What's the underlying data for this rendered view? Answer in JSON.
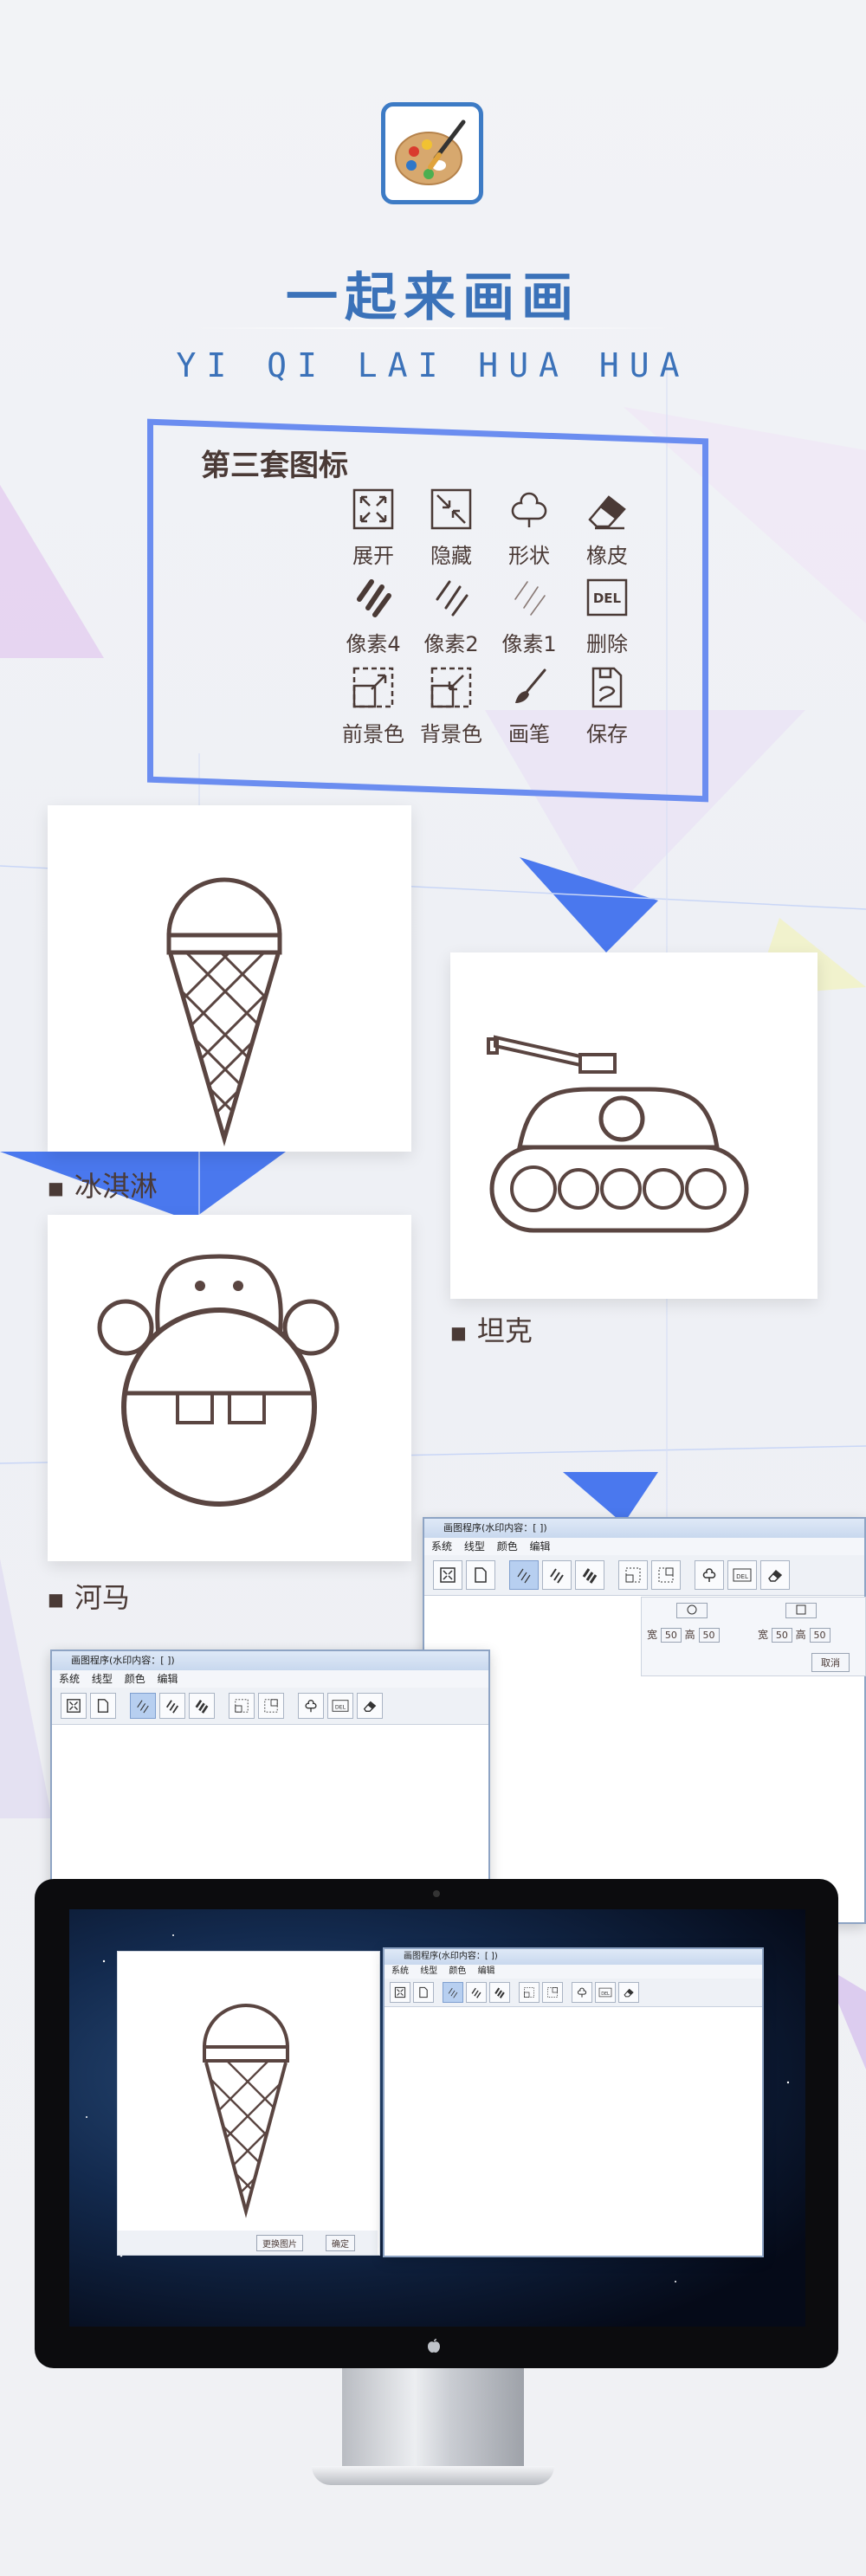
{
  "header": {
    "title": "一起来画画",
    "subtitle": "YI QI LAI HUA HUA"
  },
  "icon_set": {
    "title": "第三套图标",
    "icons": [
      {
        "label": "展开",
        "icon": "expand-icon"
      },
      {
        "label": "隐藏",
        "icon": "collapse-icon"
      },
      {
        "label": "形状",
        "icon": "cloud-shape-icon"
      },
      {
        "label": "橡皮",
        "icon": "eraser-icon"
      },
      {
        "label": "像素4",
        "icon": "pixel4-icon"
      },
      {
        "label": "像素2",
        "icon": "pixel2-icon"
      },
      {
        "label": "像素1",
        "icon": "pixel1-icon"
      },
      {
        "label": "删除",
        "icon": "delete-icon"
      },
      {
        "label": "前景色",
        "icon": "foreground-color-icon"
      },
      {
        "label": "背景色",
        "icon": "background-color-icon"
      },
      {
        "label": "画笔",
        "icon": "brush-icon"
      },
      {
        "label": "保存",
        "icon": "save-icon"
      }
    ]
  },
  "gallery": {
    "ice_cream": "冰淇淋",
    "tank": "坦克",
    "hippo": "河马"
  },
  "window_large": {
    "title": "画图程序(水印内容：[ ])",
    "menu": [
      "系统",
      "线型",
      "颜色",
      "编辑"
    ],
    "shape_panel": {
      "width_label": "宽",
      "height_label": "高",
      "value": "50",
      "cancel": "取消"
    }
  },
  "window_small": {
    "title": "画图程序(水印内容：[ ])",
    "menu": [
      "系统",
      "线型",
      "颜色",
      "编辑"
    ]
  },
  "monitor_window": {
    "title": "画图程序(水印内容：[ ])",
    "menu": [
      "系统",
      "线型",
      "颜色",
      "编辑"
    ],
    "change_button": "更换图片",
    "confirm_button": "确定"
  },
  "colors": {
    "accent": "#3b72b9",
    "frame": "#6b8df0",
    "ink": "#4a3a36"
  }
}
